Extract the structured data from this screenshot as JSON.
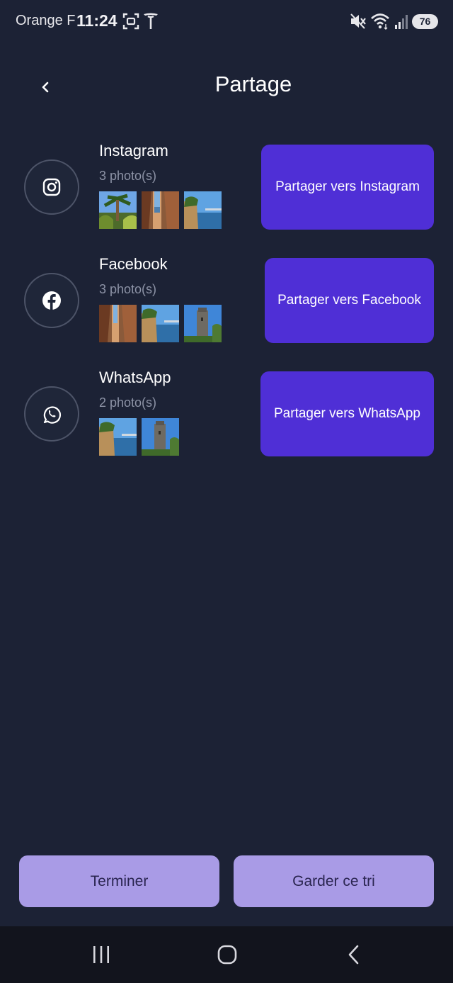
{
  "status_bar": {
    "carrier": "Orange F",
    "time": "11:24",
    "battery": "76",
    "icons": [
      "screenshot-icon",
      "tesla-icon",
      "mute-icon",
      "wifi-icon",
      "signal-icon",
      "battery-icon"
    ]
  },
  "header": {
    "back_icon": "chevron-left-icon",
    "title": "Partage"
  },
  "shares": [
    {
      "platform": "Instagram",
      "icon": "instagram-icon",
      "count_label": "3 photo(s)",
      "button_label": "Partager vers Instagram"
    },
    {
      "platform": "Facebook",
      "icon": "facebook-icon",
      "count_label": "3 photo(s)",
      "button_label": "Partager vers Facebook"
    },
    {
      "platform": "WhatsApp",
      "icon": "whatsapp-icon",
      "count_label": "2 photo(s)",
      "button_label": "Partager vers WhatsApp"
    }
  ],
  "actions": {
    "finish_label": "Terminer",
    "keep_label": "Garder ce tri"
  },
  "colors": {
    "background": "#1c2235",
    "share_button": "#4f2fd6",
    "action_button": "#a99be6",
    "action_text": "#2a2550",
    "secondary_text": "#8d93a6"
  },
  "nav_bar": {
    "icons": [
      "recent-apps-icon",
      "home-icon",
      "back-icon"
    ]
  }
}
